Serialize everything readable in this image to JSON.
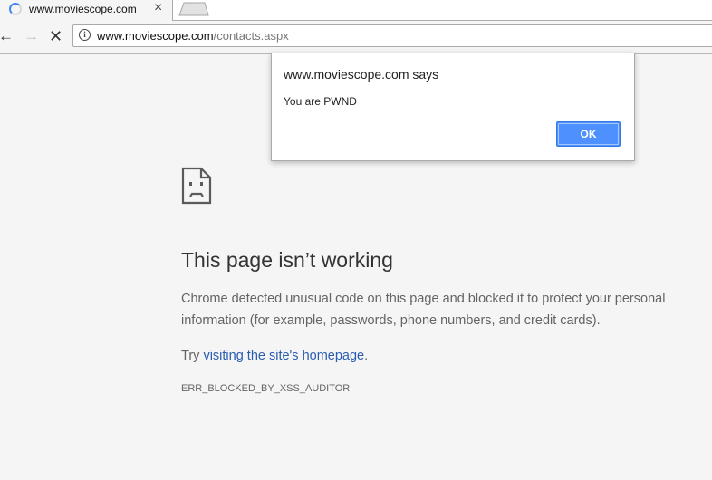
{
  "browser": {
    "tab": {
      "title": "www.moviescope.com",
      "close_glyph": "×"
    },
    "toolbar": {
      "back_glyph": "←",
      "forward_glyph": "→",
      "stop_glyph": "✕",
      "info_glyph": "i"
    },
    "omnibox": {
      "url_host": "www.moviescope.com",
      "url_path": "/contacts.aspx"
    }
  },
  "error_page": {
    "icon": "sad-page-icon",
    "heading": "This page isn’t working",
    "body": "Chrome detected unusual code on this page and blocked it to protect your personal information (for example, passwords, phone numbers, and credit cards).",
    "try_prefix": "Try ",
    "try_link": "visiting the site's homepage",
    "try_suffix": ".",
    "error_code": "ERR_BLOCKED_BY_XSS_AUDITOR"
  },
  "dialog": {
    "title": "www.moviescope.com says",
    "message": "You are PWND",
    "ok_label": "OK"
  },
  "colors": {
    "page_background": "#f5f5f5",
    "link": "#2a5db0",
    "ok_button": "#4d90fe",
    "spinner": "#4285f4"
  }
}
